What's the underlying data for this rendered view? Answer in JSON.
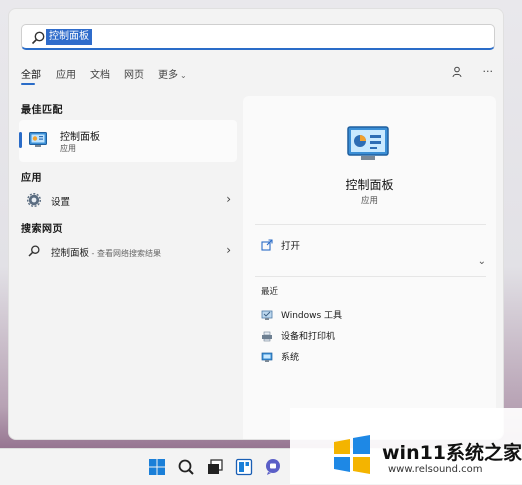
{
  "search": {
    "query": "控制面板"
  },
  "tabs": [
    {
      "label": "全部",
      "active": true
    },
    {
      "label": "应用"
    },
    {
      "label": "文档"
    },
    {
      "label": "网页"
    },
    {
      "label": "更多"
    }
  ],
  "toolbar_icons": [
    "share-account-icon",
    "more-options-icon"
  ],
  "more_menu_glyph": "···",
  "best_match": {
    "section_label": "最佳匹配",
    "title": "控制面板",
    "subtitle": "应用"
  },
  "apps": {
    "section_label": "应用",
    "items": [
      {
        "label": "设置",
        "icon": "gear-icon"
      }
    ]
  },
  "web": {
    "section_label": "搜索网页",
    "items": [
      {
        "label": "控制面板",
        "suffix": " - 查看网络搜索结果",
        "icon": "search-icon"
      }
    ]
  },
  "detail": {
    "title": "控制面板",
    "subtitle": "应用",
    "open_label": "打开",
    "recent_label": "最近",
    "recent_items": [
      {
        "label": "Windows 工具",
        "icon": "windows-tools-icon"
      },
      {
        "label": "设备和打印机",
        "icon": "devices-printers-icon"
      },
      {
        "label": "系统",
        "icon": "system-icon"
      }
    ]
  },
  "taskbar": [
    "windows-start-icon",
    "search-icon",
    "task-view-icon",
    "widgets-icon",
    "chat-icon"
  ],
  "watermark": {
    "title": "win11系统之家",
    "url": "www.relsound.com"
  },
  "colors": {
    "accent": "#2a6cc8",
    "panel": "#f3f3f3",
    "detail": "#fafafa"
  }
}
